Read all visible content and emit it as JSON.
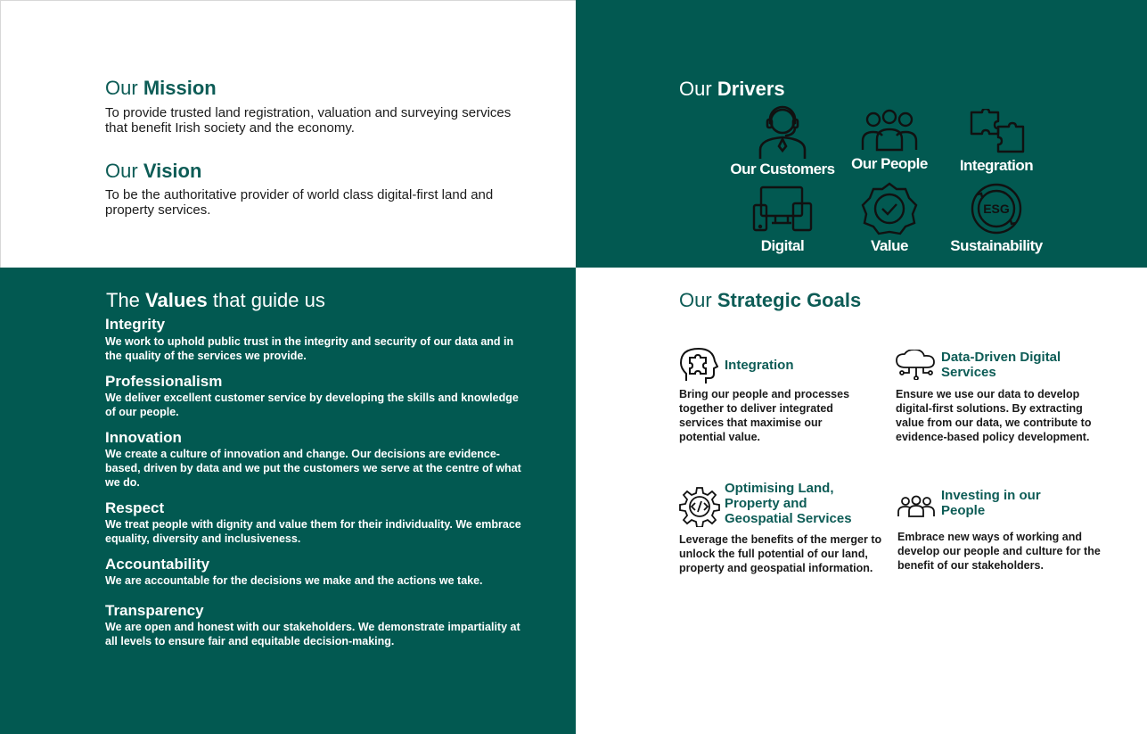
{
  "mission": {
    "prefix": "Our",
    "title": "Mission",
    "text": "To provide trusted land registration, valuation and surveying services that benefit Irish society and the economy."
  },
  "vision": {
    "prefix": "Our",
    "title": "Vision",
    "text": "To be the authoritative provider of world class digital-first land and property services."
  },
  "drivers": {
    "prefix": "Our",
    "title": "Drivers",
    "items": [
      {
        "label": "Our Customers",
        "icon": "headset-person-icon"
      },
      {
        "label": "Our People",
        "icon": "people-group-icon"
      },
      {
        "label": "Integration",
        "icon": "puzzle-icon"
      },
      {
        "label": "Digital",
        "icon": "devices-icon"
      },
      {
        "label": "Value",
        "icon": "check-badge-icon"
      },
      {
        "label": "Sustainability",
        "icon": "esg-icon"
      }
    ]
  },
  "values": {
    "prefix": "The",
    "title": "Values",
    "suffix": "that guide us",
    "items": [
      {
        "title": "Integrity",
        "text": "We work to uphold public trust in the integrity and security of our data and in the quality of the services we provide."
      },
      {
        "title": "Professionalism",
        "text": "We deliver excellent customer service by developing the skills and knowledge of our people."
      },
      {
        "title": "Innovation",
        "text": "We create a culture of innovation and change. Our decisions are evidence-based, driven by data and we put the customers we serve at the centre of what we do."
      },
      {
        "title": "Respect",
        "text": "We treat people with dignity and value them for their individuality. We embrace equality, diversity and inclusiveness."
      },
      {
        "title": "Accountability",
        "text": "We are accountable for the decisions we make and the actions we take."
      },
      {
        "title": "Transparency",
        "text": "We are open and honest with our stakeholders. We demonstrate impartiality at all levels to ensure fair and equitable decision-making."
      }
    ]
  },
  "goals": {
    "prefix": "Our",
    "title": "Strategic Goals",
    "items": [
      {
        "title": "Integration",
        "text": "Bring our people and processes together to deliver integrated services that maximise our potential value.",
        "icon": "puzzle-head-icon"
      },
      {
        "title": "Data-Driven Digital Services",
        "text": "Ensure we use our data to develop digital-first solutions. By extracting value from our data, we contribute to evidence-based policy development.",
        "icon": "cloud-network-icon"
      },
      {
        "title": "Optimising Land, Property and Geospatial Services",
        "text": "Leverage the benefits of the merger to unlock the full potential of our land, property and geospatial information.",
        "icon": "gear-code-icon"
      },
      {
        "title": "Investing in our People",
        "text": "Embrace new ways of working and develop our people and culture for the benefit of our stakeholders.",
        "icon": "people-group-icon"
      }
    ]
  },
  "colors": {
    "teal": "#025951",
    "teal_text": "#0d5c56",
    "white": "#ffffff"
  }
}
